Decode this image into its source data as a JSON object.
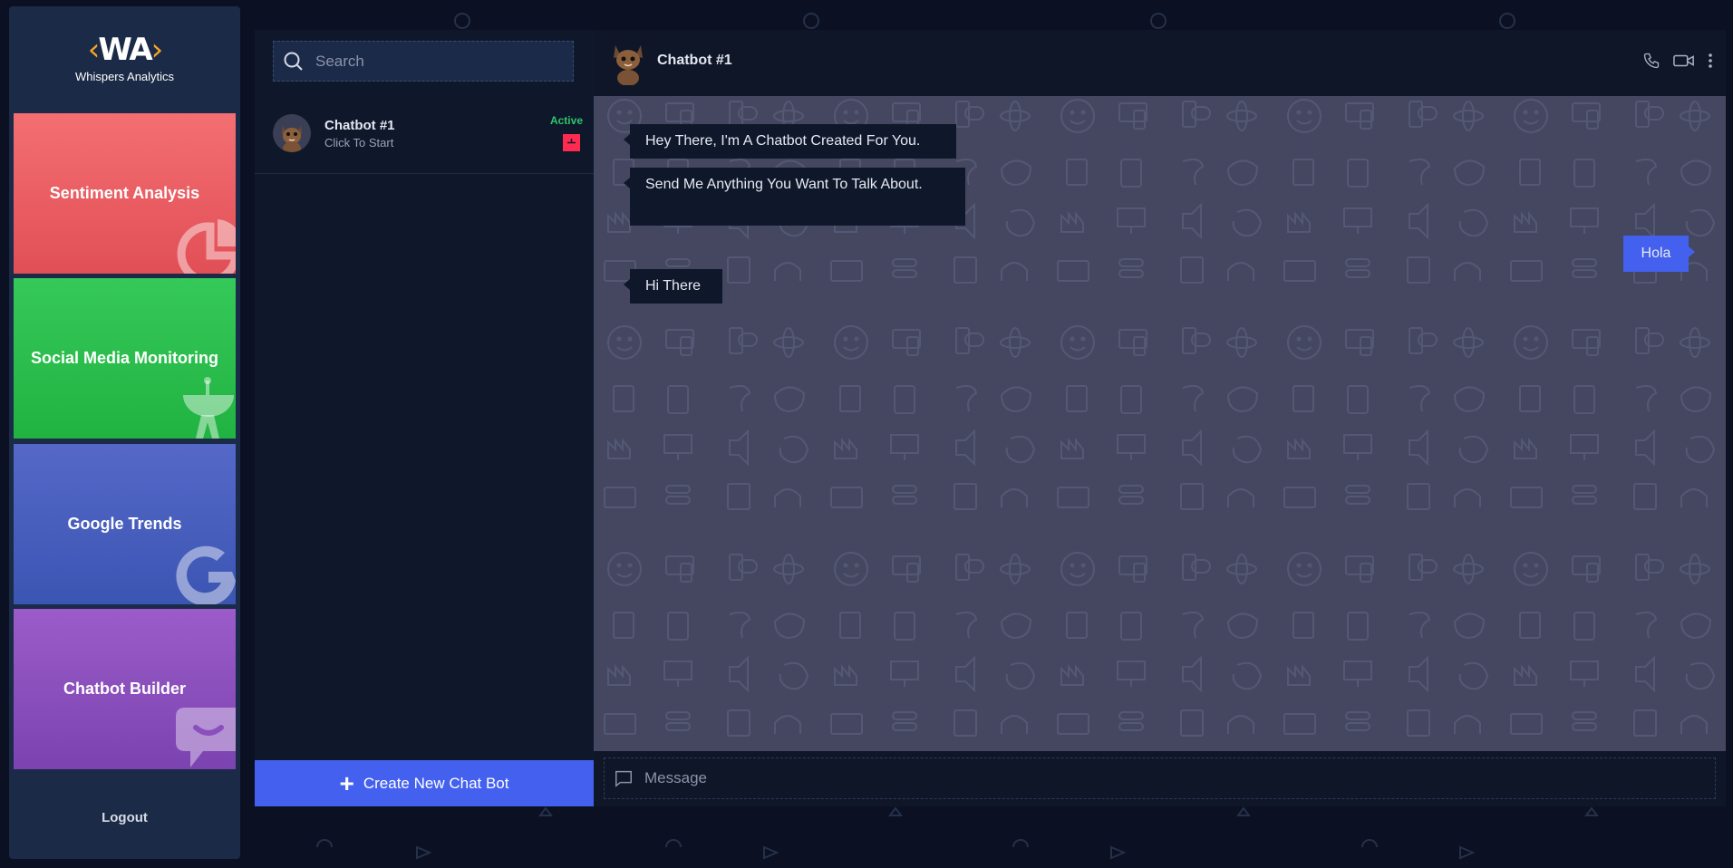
{
  "brand": {
    "mark": "WA",
    "name": "Whispers Analytics"
  },
  "nav": {
    "cards": [
      {
        "label": "Sentiment Analysis",
        "icon": "pie-chart-icon"
      },
      {
        "label": "Social Media Monitoring",
        "icon": "satellite-dish-icon"
      },
      {
        "label": "Google Trends",
        "icon": "google-g-icon"
      },
      {
        "label": "Chatbot Builder",
        "icon": "chat-bubble-icon"
      }
    ],
    "logout": "Logout"
  },
  "chat_list": {
    "search_placeholder": "Search",
    "items": [
      {
        "name": "Chatbot #1",
        "subtitle": "Click To Start",
        "status": "Active",
        "status_color": "#2ec66a",
        "badge_color": "#ff2a4f"
      }
    ],
    "create_button": "Create New Chat Bot"
  },
  "conversation": {
    "title": "Chatbot #1",
    "header_icons": [
      "phone-icon",
      "video-icon",
      "more-vertical-icon"
    ],
    "messages": [
      {
        "from": "bot",
        "text": "Hey There, I'm A Chatbot Created For You."
      },
      {
        "from": "bot",
        "text": "Send Me Anything You Want To Talk About."
      },
      {
        "from": "user",
        "text": "Hola"
      },
      {
        "from": "bot",
        "text": "Hi There"
      }
    ],
    "composer_placeholder": "Message"
  },
  "colors": {
    "accent": "#4361ee",
    "active": "#2ec66a",
    "background": "#0b1122",
    "chat_bg": "#44475f"
  }
}
